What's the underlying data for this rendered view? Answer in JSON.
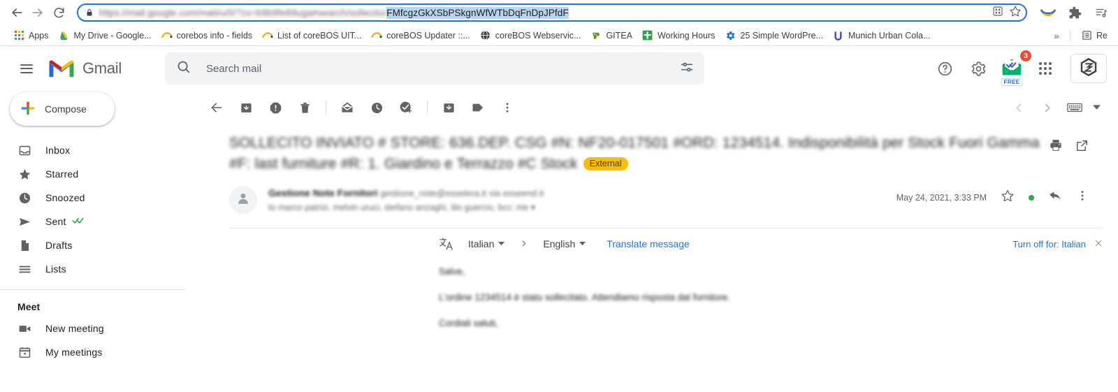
{
  "browser": {
    "nav": {
      "back_icon": "arrow-left-icon",
      "forward_icon": "arrow-right-icon",
      "reload_icon": "reload-icon"
    },
    "omnibox": {
      "lock_icon": "lock-icon",
      "url_blurred": "https://mail.google.com/mail/u/0/?zx=b9b9fe69uga#search/sollecito/",
      "url_selected": "FMfcgzGkXSbPSkgnWfWTbDqFnDpJPfdF",
      "qr_icon": "qr-code-icon",
      "bookmark_icon": "star-icon"
    },
    "toolbar_icons": [
      {
        "name": "smile-arc-extension-icon"
      },
      {
        "name": "puzzle-extensions-icon"
      },
      {
        "name": "media-playlist-icon"
      }
    ],
    "bookmarks": {
      "apps_label": "Apps",
      "items": [
        {
          "label": "My Drive - Google...",
          "icon": "google-drive-icon"
        },
        {
          "label": "corebos info - fields",
          "icon": "corebos-icon"
        },
        {
          "label": "List of coreBOS UIT...",
          "icon": "corebos-icon"
        },
        {
          "label": "coreBOS Updater ::...",
          "icon": "corebos-icon"
        },
        {
          "label": "coreBOS Webservic...",
          "icon": "globe-icon"
        },
        {
          "label": "GITEA",
          "icon": "gitea-icon"
        },
        {
          "label": "Working Hours",
          "icon": "plus-green-icon"
        },
        {
          "label": "25 Simple WordPre...",
          "icon": "gear-blue-icon"
        },
        {
          "label": "Munich Urban Cola...",
          "icon": "munich-icon"
        }
      ],
      "overflow_label": "»",
      "reading_list_label": "Re",
      "reading_list_icon": "reading-list-icon"
    }
  },
  "gmail": {
    "header": {
      "menu_icon": "hamburger-menu-icon",
      "logo_icon": "gmail-logo-icon",
      "logo_text": "Gmail",
      "search": {
        "icon": "search-icon",
        "placeholder": "Search mail",
        "value": "",
        "options_icon": "search-options-icon"
      },
      "support_icon": "help-icon",
      "settings_icon": "gear-icon",
      "tracker": {
        "icon": "mailtrack-envelope-icon",
        "badge": "3",
        "tag": "FREE"
      },
      "apps_icon": "google-apps-grid-icon",
      "avatar_icon": "account-avatar-icon"
    },
    "sidebar": {
      "compose": {
        "label": "Compose",
        "icon": "compose-plus-icon"
      },
      "items": [
        {
          "label": "Inbox",
          "icon": "inbox-icon"
        },
        {
          "label": "Starred",
          "icon": "star-icon"
        },
        {
          "label": "Snoozed",
          "icon": "clock-icon"
        },
        {
          "label": "Sent",
          "icon": "send-icon",
          "suffix_icon": "double-check-icon"
        },
        {
          "label": "Drafts",
          "icon": "draft-page-icon"
        },
        {
          "label": "Lists",
          "icon": "lists-icon"
        }
      ],
      "meet": {
        "title": "Meet",
        "items": [
          {
            "label": "New meeting",
            "icon": "video-camera-icon"
          },
          {
            "label": "My meetings",
            "icon": "calendar-icon"
          }
        ]
      }
    },
    "toolbar": {
      "back_icon": "back-to-inbox-icon",
      "archive_icon": "archive-icon",
      "spam_icon": "report-spam-icon",
      "delete_icon": "delete-trash-icon",
      "unread_icon": "mark-as-unread-icon",
      "snooze_icon": "snooze-clock-icon",
      "task_icon": "add-to-tasks-icon",
      "move_icon": "move-to-icon",
      "label_icon": "labels-tag-icon",
      "more_icon": "more-vertical-icon",
      "prev_icon": "previous-chevron-icon",
      "next_icon": "next-chevron-icon",
      "input_tools_icon": "keyboard-input-tools-icon",
      "input_tools_caret_icon": "caret-down-icon"
    },
    "message": {
      "subject": "SOLLECITO INVIATO # STORE: 636.DEP. CSG #N: NF20-017501 #ORD: 1234514. Indisponibilità per Stock Fuori Gamma #F: last furniture #R: 1. Giardino e Terrazzo #C Stock",
      "external_badge": "External",
      "print_icon": "print-icon",
      "popout_icon": "open-in-new-window-icon",
      "sender_name": "Gestione Note Fornitori",
      "sender_email": "gestione_note@esselera.it",
      "sender_via": "via esseend.it",
      "recipients": "to marco patrizi, melvin uruci, stefano anzaghi, tilo guercio, bcc: me",
      "recipients_caret_icon": "caret-down-icon",
      "date": "May 24, 2021, 3:33 PM",
      "star_icon": "star-outline-icon",
      "status_dot": "green-status-dot",
      "reply_icon": "reply-arrow-icon",
      "more_icon": "more-vertical-icon",
      "avatar_icon": "person-avatar-icon",
      "body": [
        "Salve,",
        "L'ordine 1234514 è stato sollecitato. Attendiamo risposta dal fornitore.",
        "Cordiali saluti,"
      ]
    },
    "translate": {
      "icon": "translate-icon",
      "source_lang": "Italian",
      "arrow": "›",
      "target_lang": "English",
      "action_label": "Translate message",
      "turn_off_label": "Turn off for: Italian",
      "close_icon": "close-x-icon",
      "caret_icon": "caret-down-icon"
    }
  },
  "colors": {
    "accent_blue": "#1a73e8",
    "external_badge": "#fbbc04",
    "badge_red": "#ea4c3a",
    "status_green": "#34a853"
  }
}
